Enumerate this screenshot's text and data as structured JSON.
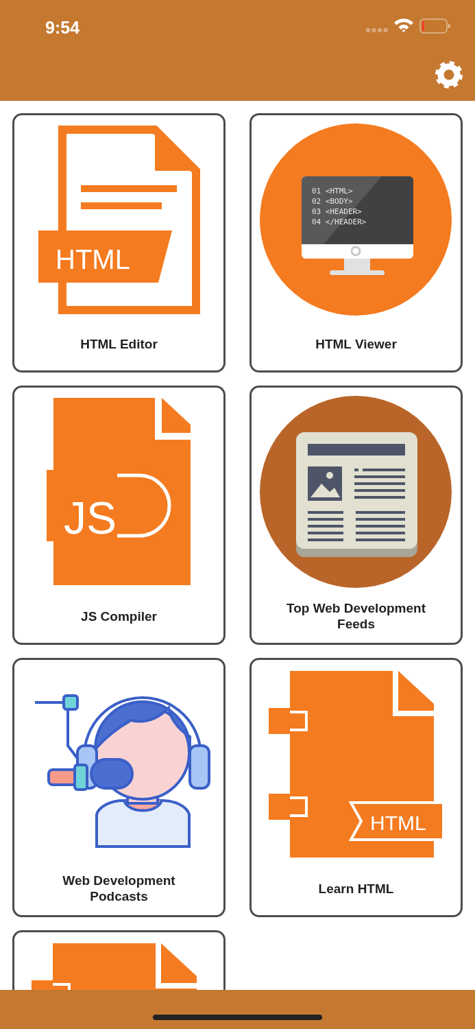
{
  "status_bar": {
    "time": "9:54"
  },
  "tiles": [
    {
      "label": "HTML Editor",
      "icon": {
        "kind": "html-file",
        "text": "HTML"
      }
    },
    {
      "label": "HTML Viewer",
      "icon": {
        "kind": "monitor",
        "lines": [
          "01 <HTML>",
          "02 <BODY>",
          "03 <HEADER>",
          "04 </HEADER>"
        ]
      }
    },
    {
      "label": "JS Compiler",
      "icon": {
        "kind": "js-file",
        "text": "JS"
      }
    },
    {
      "label": "Top Web Development Feeds",
      "icon": {
        "kind": "newspaper"
      }
    },
    {
      "label": "Web Development Podcasts",
      "icon": {
        "kind": "podcaster"
      }
    },
    {
      "label": "Learn HTML",
      "icon": {
        "kind": "binder",
        "text": "HTML"
      }
    },
    {
      "icon": {
        "kind": "binder"
      }
    }
  ]
}
